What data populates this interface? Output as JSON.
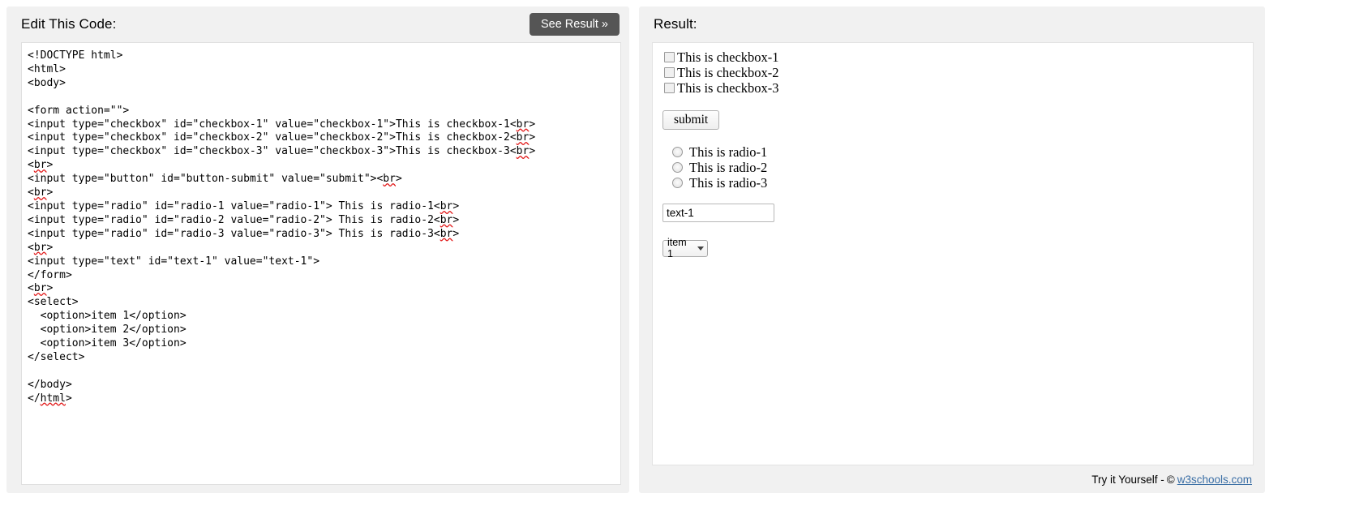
{
  "editor": {
    "title": "Edit This Code:",
    "see_result_label": "See Result »",
    "code": "<!DOCTYPE html>\n<html>\n<body>\n\n<form action=\"\">\n<input type=\"checkbox\" id=\"checkbox-1\" value=\"checkbox-1\">This is checkbox-1<br>\n<input type=\"checkbox\" id=\"checkbox-2\" value=\"checkbox-2\">This is checkbox-2<br>\n<input type=\"checkbox\" id=\"checkbox-3\" value=\"checkbox-3\">This is checkbox-3<br>\n<br>\n<input type=\"button\" id=\"button-submit\" value=\"submit\"><br>\n<br>\n<input type=\"radio\" id=\"radio-1 value=\"radio-1\"> This is radio-1<br>\n<input type=\"radio\" id=\"radio-2 value=\"radio-2\"> This is radio-2<br>\n<input type=\"radio\" id=\"radio-3 value=\"radio-3\"> This is radio-3<br>\n<br>\n<input type=\"text\" id=\"text-1\" value=\"text-1\">\n</form>\n<br>\n<select>\n  <option>item 1</option>\n  <option>item 2</option>\n  <option>item 3</option>\n</select>\n\n</body>\n</html>"
  },
  "result": {
    "title": "Result:",
    "checkboxes": [
      {
        "label": "This is checkbox-1",
        "checked": false
      },
      {
        "label": "This is checkbox-2",
        "checked": false
      },
      {
        "label": "This is checkbox-3",
        "checked": false
      }
    ],
    "submit_label": "submit",
    "radios": [
      {
        "label": "This is radio-1",
        "checked": false
      },
      {
        "label": "This is radio-2",
        "checked": false
      },
      {
        "label": "This is radio-3",
        "checked": false
      }
    ],
    "text_input_value": "text-1",
    "select": {
      "selected": "item 1",
      "options": [
        "item 1",
        "item 2",
        "item 3"
      ]
    },
    "footer": {
      "prefix": "Try it Yourself -",
      "copyright": "©",
      "link": "w3schools.com"
    }
  }
}
